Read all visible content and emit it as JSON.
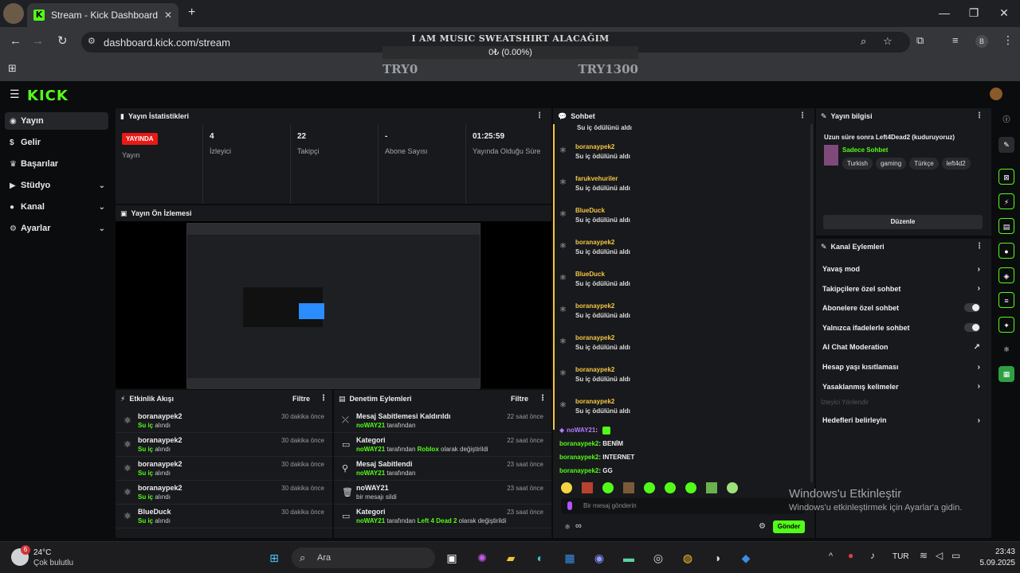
{
  "browser": {
    "tab_title": "Stream - Kick Dashboard",
    "url": "dashboard.kick.com/stream",
    "profile_initial": "B"
  },
  "overlay": {
    "title": "I AM MUSIC SWEATSHIRT ALACAĞIM",
    "progress_text": "0₺ (0.00%)",
    "progress_fraction": 0.0,
    "min_label": "TRY0",
    "max_label": "TRY1300"
  },
  "app": {
    "logo": "KICK",
    "accent": "#53fc18"
  },
  "sidebar": {
    "items": [
      {
        "label": "Yayın",
        "icon": "broadcast-icon",
        "expandable": false
      },
      {
        "label": "Gelir",
        "icon": "money-icon",
        "expandable": false
      },
      {
        "label": "Başarılar",
        "icon": "trophy-icon",
        "expandable": false
      },
      {
        "label": "Stüdyo",
        "icon": "studio-icon",
        "expandable": true
      },
      {
        "label": "Kanal",
        "icon": "user-icon",
        "expandable": true
      },
      {
        "label": "Ayarlar",
        "icon": "gear-icon",
        "expandable": true
      }
    ]
  },
  "stats": {
    "title": "Yayın İstatistikleri",
    "live_badge": "YAYINDA",
    "live_label": "Yayın",
    "cells": [
      {
        "value": "4",
        "label": "İzleyici"
      },
      {
        "value": "22",
        "label": "Takipçi"
      },
      {
        "value": "-",
        "label": "Abone Sayısı"
      },
      {
        "value": "01:25:59",
        "label": "Yayında Olduğu Süre"
      }
    ]
  },
  "preview": {
    "title": "Yayın Ön İzlemesi"
  },
  "activity": {
    "title": "Etkinlik Akışı",
    "filter": "Filtre",
    "rows": [
      {
        "user": "boranaypek2",
        "action_green": "Su iç",
        "action_rest": " alındı",
        "time": "30 dakika önce"
      },
      {
        "user": "boranaypek2",
        "action_green": "Su iç",
        "action_rest": " alındı",
        "time": "30 dakika önce"
      },
      {
        "user": "boranaypek2",
        "action_green": "Su iç",
        "action_rest": " alındı",
        "time": "30 dakika önce"
      },
      {
        "user": "boranaypek2",
        "action_green": "Su iç",
        "action_rest": " alındı",
        "time": "30 dakika önce"
      },
      {
        "user": "BlueDuck",
        "action_green": "Su iç",
        "action_rest": " alındı",
        "time": "30 dakika önce"
      }
    ]
  },
  "moderation": {
    "title": "Denetim Eylemleri",
    "filter": "Filtre",
    "rows": [
      {
        "title": "Mesaj Sabitlemesi Kaldırıldı",
        "actor": "noWAY21",
        "pre": " tarafından",
        "hl": "",
        "post": "",
        "time": "22 saat önce",
        "icon": "unpin-icon"
      },
      {
        "title": "Kategori",
        "actor": "noWAY21",
        "pre": " tarafından ",
        "hl": "Roblox",
        "post": " olarak değiştirildi",
        "time": "22 saat önce",
        "icon": "category-icon"
      },
      {
        "title": "Mesaj Sabitlendi",
        "actor": "noWAY21",
        "pre": " tarafından",
        "hl": "",
        "post": "",
        "time": "23 saat önce",
        "icon": "pin-icon"
      },
      {
        "title": "noWAY21",
        "actor": "",
        "pre": "bir mesajı sildi",
        "hl": "",
        "post": "",
        "time": "23 saat önce",
        "icon": "trash-icon"
      },
      {
        "title": "Kategori",
        "actor": "noWAY21",
        "pre": " tarafından ",
        "hl": "Left 4 Dead 2",
        "post": " olarak değiştirildi",
        "time": "23 saat önce",
        "icon": "category-icon"
      }
    ]
  },
  "chat": {
    "title": "Sohbet",
    "top_partial": "Su iç ödülünü aldı",
    "redeems": [
      {
        "user": "boranaypek2",
        "msg": "Su iç ödülünü aldı",
        "color": "#f5c542"
      },
      {
        "user": "farukvehuriler",
        "msg": "Su iç ödülünü aldı",
        "color": "#f5c542"
      },
      {
        "user": "BlueDuck",
        "msg": "Su iç ödülünü aldı",
        "color": "#f5c542"
      },
      {
        "user": "boranaypek2",
        "msg": "Su iç ödülünü aldı",
        "color": "#f5c542"
      },
      {
        "user": "BlueDuck",
        "msg": "Su iç ödülünü aldı",
        "color": "#f5c542"
      },
      {
        "user": "boranaypek2",
        "msg": "Su iç ödülünü aldı",
        "color": "#f5c542"
      },
      {
        "user": "boranaypek2",
        "msg": "Su iç ödülünü aldı",
        "color": "#f5c542"
      },
      {
        "user": "boranaypek2",
        "msg": "Su iç ödülünü aldı",
        "color": "#f5c542"
      },
      {
        "user": "boranaypek2",
        "msg": "Su iç ödülünü aldı",
        "color": "#f5c542"
      }
    ],
    "messages": [
      {
        "user": "noWAY21",
        "sep": ":",
        "text": "",
        "color": "#b17cff"
      },
      {
        "user": "boranaypek2",
        "sep": ":",
        "text": " BENİM",
        "color": "#53fc18"
      },
      {
        "user": "boranaypek2",
        "sep": ":",
        "text": " INTERNET",
        "color": "#53fc18"
      },
      {
        "user": "boranaypek2",
        "sep": ":",
        "text": " GG",
        "color": "#53fc18"
      }
    ],
    "input_placeholder": "Bir mesaj gönderin",
    "send": "Gönder",
    "infinity": "∞"
  },
  "stream_info": {
    "title": "Yayın bilgisi",
    "stream_title": "Uzun süre sonra Left4Dead2 (kuduruyoruz)",
    "category": "Sadece Sohbet",
    "tags": [
      "Turkish",
      "gaming",
      "Türkçe",
      "left4d2"
    ],
    "edit": "Düzenle"
  },
  "channel_actions": {
    "title": "Kanal Eylemleri",
    "items": [
      {
        "label": "Yavaş mod",
        "control": "chevron"
      },
      {
        "label": "Takipçilere özel sohbet",
        "control": "chevron"
      },
      {
        "label": "Abonelere özel sohbet",
        "control": "toggle"
      },
      {
        "label": "Yalnızca ifadelerle sohbet",
        "control": "toggle"
      },
      {
        "label": "AI Chat Moderation",
        "control": "external"
      },
      {
        "label": "Hesap yaşı kısıtlaması",
        "control": "chevron"
      },
      {
        "label": "Yasaklanmış kelimeler",
        "control": "chevron"
      }
    ],
    "section_label": "İzleyici Yönlendir",
    "target": "Hedefleri belirleyin"
  },
  "watermark": {
    "line1": "Windows'u Etkinleştir",
    "line2": "Windows'u etkinleştirmek için Ayarlar'a gidin."
  },
  "taskbar": {
    "weather_temp": "24°C",
    "weather_desc": "Çok bulutlu",
    "weather_badge": "6",
    "search": "Ara",
    "lang": "TUR",
    "time": "23:43",
    "date": "5.09.2025"
  }
}
